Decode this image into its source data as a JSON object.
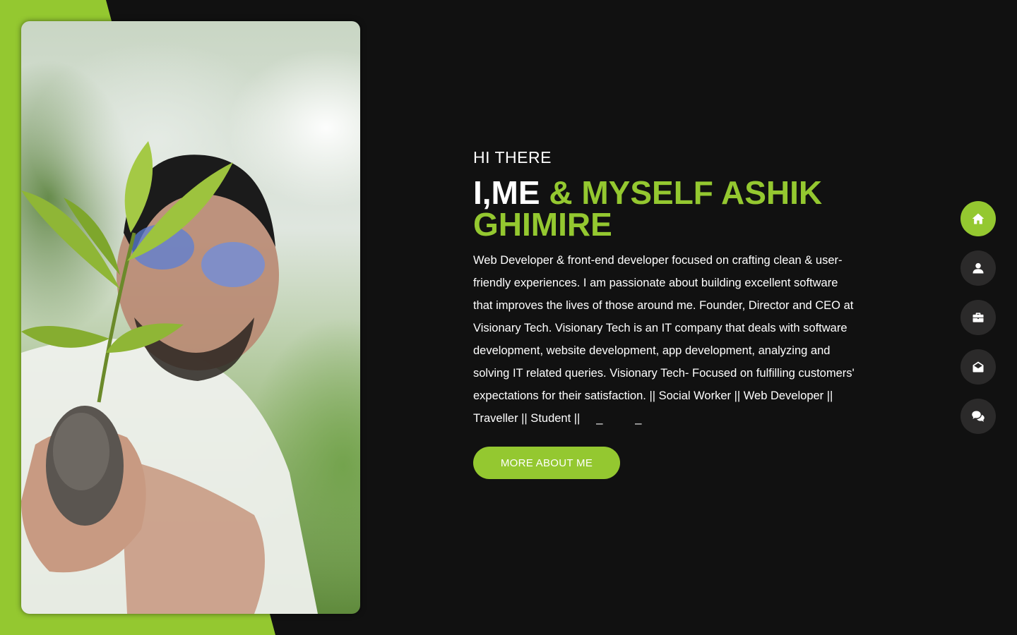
{
  "hero": {
    "greeting": "HI THERE",
    "headline_white": "I,ME ",
    "headline_green": "& MYSELF ASHIK GHIMIRE",
    "bio": "Web Developer & front-end developer focused on crafting clean & user-friendly experiences. I am passionate about building excellent software that improves the lives of those around me. Founder, Director and CEO at Visionary Tech. Visionary Tech is an IT company that deals with software development, website development, app development, analyzing and solving IT related queries. Visionary Tech- Focused on fulfilling customers' expectations for their satisfaction. || Social Worker || Web Developer || Traveller || Student ||     _          _",
    "button_label": "MORE ABOUT ME"
  },
  "nav": {
    "items": [
      {
        "icon": "home-icon",
        "active": true
      },
      {
        "icon": "user-icon",
        "active": false
      },
      {
        "icon": "briefcase-icon",
        "active": false
      },
      {
        "icon": "envelope-open-icon",
        "active": false
      },
      {
        "icon": "comments-icon",
        "active": false
      }
    ]
  },
  "colors": {
    "accent": "#94c830",
    "background": "#111111",
    "nav_inactive": "#2b2a2a"
  }
}
